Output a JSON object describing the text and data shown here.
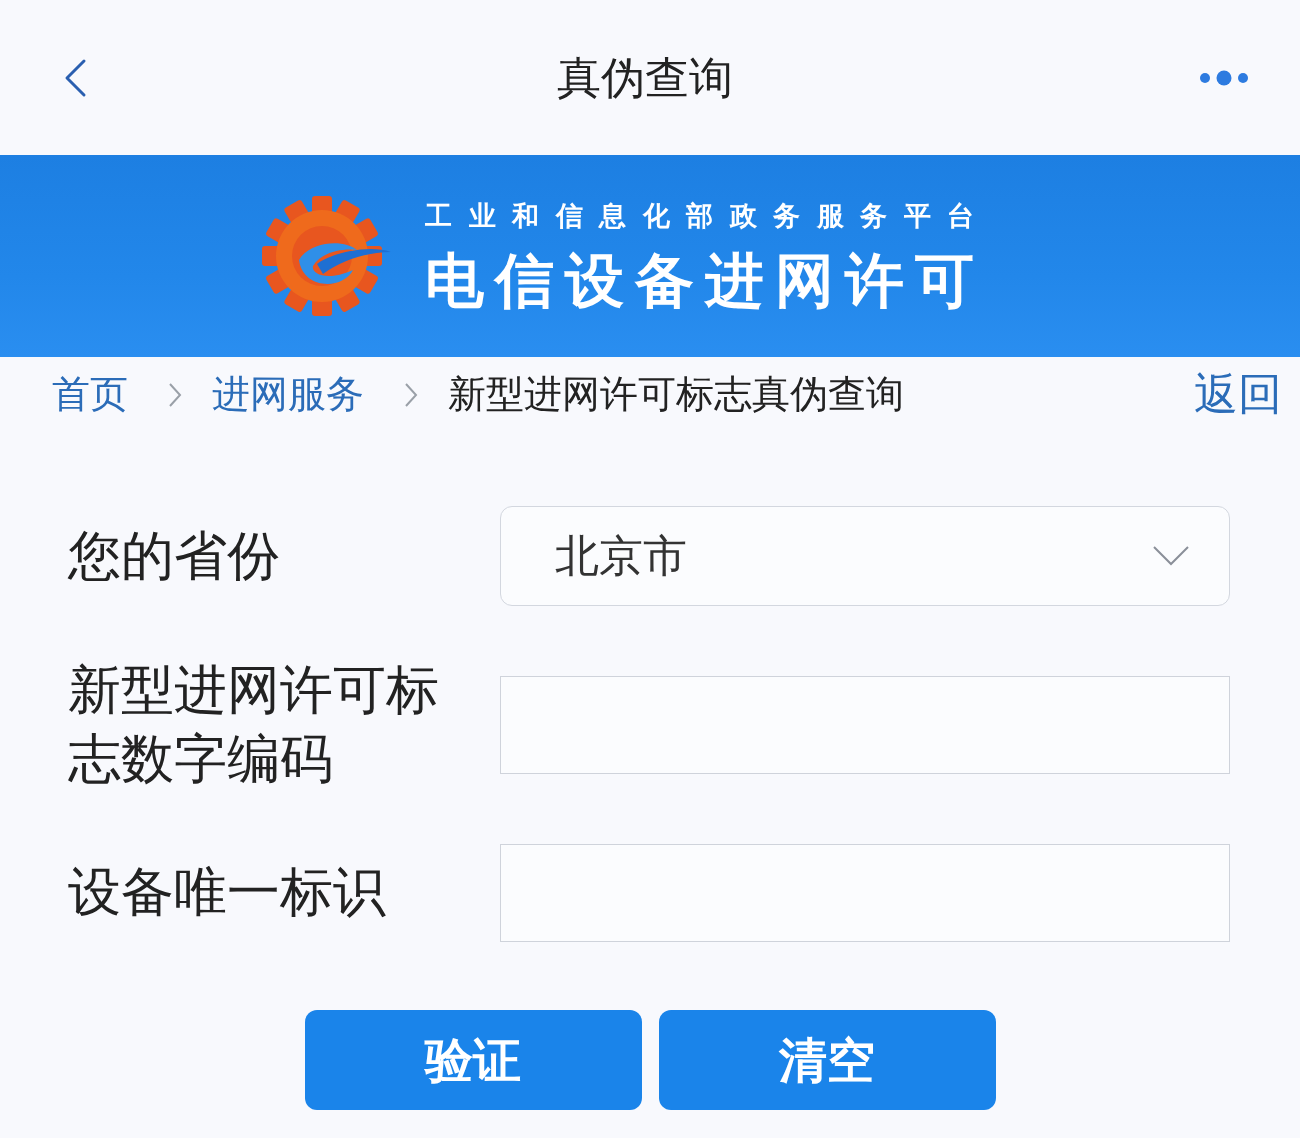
{
  "header": {
    "title": "真伪查询"
  },
  "banner": {
    "subtitle": "工业和信息化部政务服务平台",
    "title": "电信设备进网许可"
  },
  "breadcrumb": {
    "items": [
      {
        "label": "首页",
        "current": false
      },
      {
        "label": "进网服务",
        "current": false
      },
      {
        "label": "新型进网许可标志真伪查询",
        "current": true
      }
    ],
    "back_link": "返回"
  },
  "form": {
    "fields": [
      {
        "kind": "select",
        "label": "您的省份",
        "value": "北京市"
      },
      {
        "kind": "text",
        "label": "新型进网许可标志数字编码"
      },
      {
        "kind": "text",
        "label": "设备唯一标识"
      }
    ]
  },
  "buttons": [
    "验证",
    "清空"
  ]
}
